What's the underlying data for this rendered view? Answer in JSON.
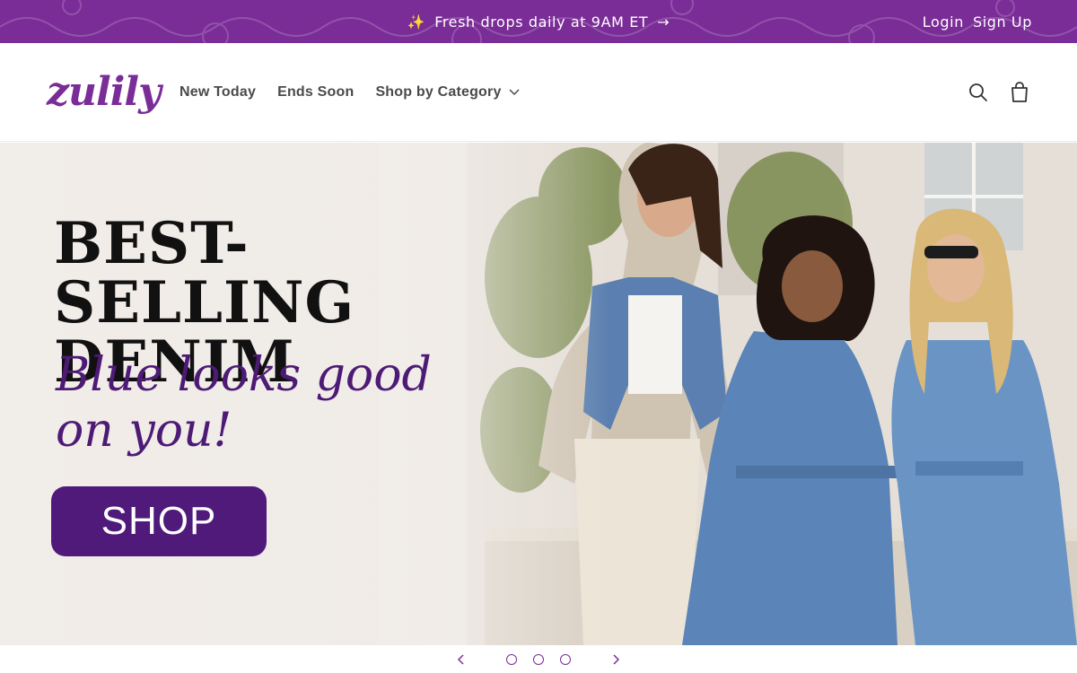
{
  "announcement": {
    "sparkle": "✨",
    "message": "Fresh drops daily at 9AM ET",
    "arrow": "→"
  },
  "account": {
    "login": "Login",
    "signup": "Sign Up"
  },
  "header": {
    "logo_text": "zulily",
    "nav": [
      {
        "label": "New Today"
      },
      {
        "label": "Ends Soon"
      },
      {
        "label": "Shop by Category",
        "dropdown": true
      }
    ],
    "icons": [
      "search-icon",
      "cart-icon"
    ]
  },
  "hero": {
    "title_line1": "BEST-SELLING",
    "title_line2": "DENIM",
    "subtitle_line1": "Blue looks good",
    "subtitle_line2": "on you!",
    "button": "SHOP"
  },
  "slider": {
    "slide_count": 3,
    "prev_icon": "chevron-left-icon",
    "next_icon": "chevron-right-icon"
  },
  "colors": {
    "brand_purple": "#7a2c97",
    "button_purple": "#4f1a7a",
    "subtitle_purple": "#4d1a75"
  }
}
